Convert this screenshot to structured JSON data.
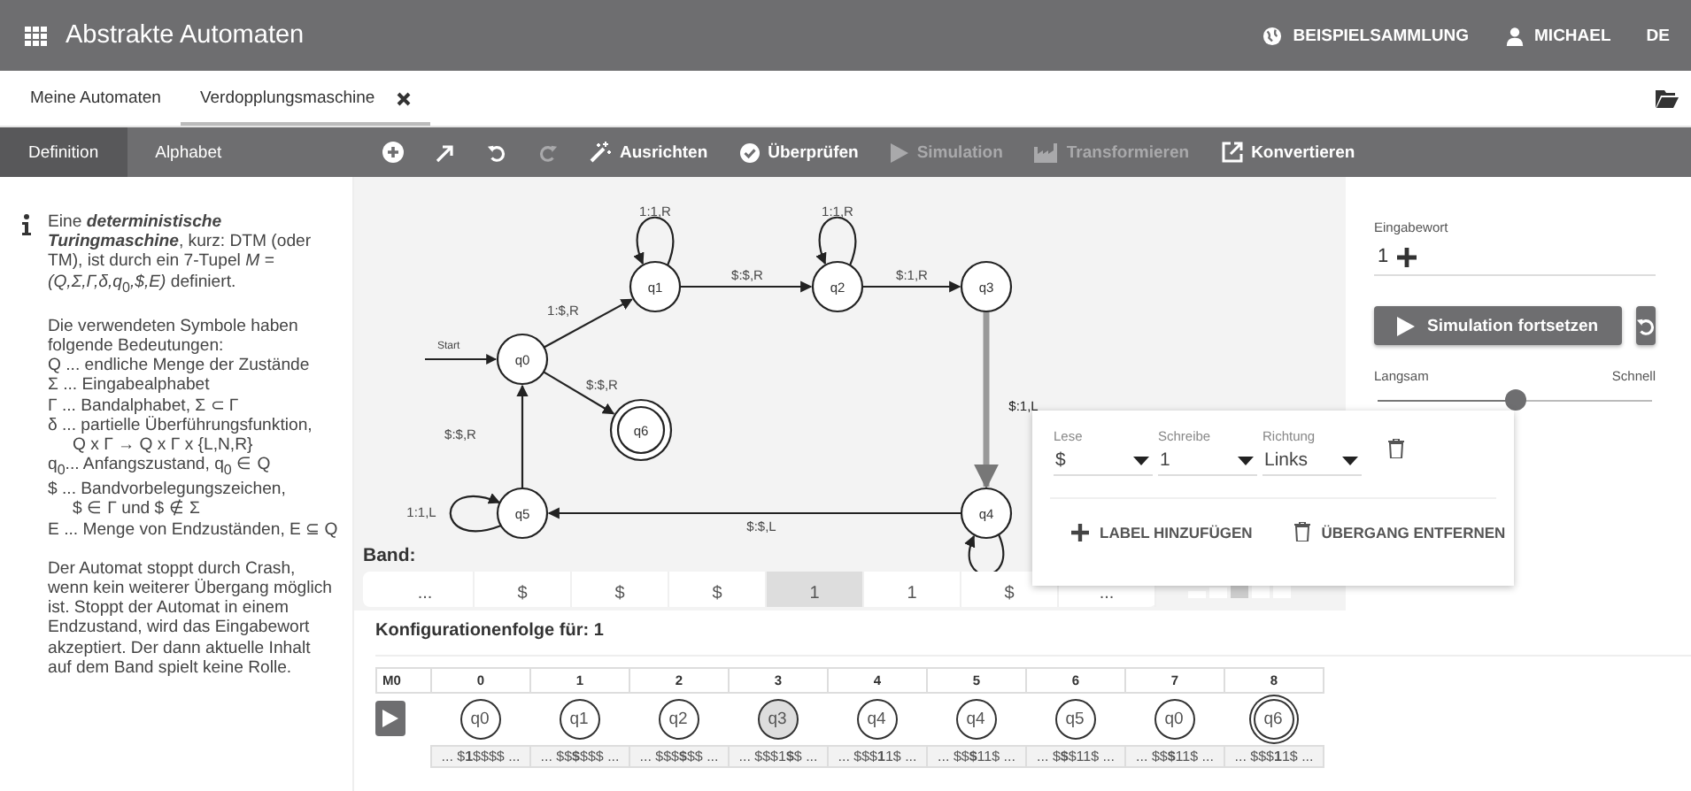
{
  "header": {
    "title": "Abstrakte Automaten",
    "links": [
      {
        "label": "BEISPIELSAMMLUNG"
      },
      {
        "label": "MICHAEL"
      },
      {
        "label": "DE"
      }
    ]
  },
  "tabs": [
    {
      "label": "Meine Automaten",
      "selected": false,
      "closable": false
    },
    {
      "label": "Verdopplungsmaschine",
      "selected": true,
      "closable": true
    }
  ],
  "toolbar": {
    "tabs": [
      {
        "label": "Definition",
        "selected": true
      },
      {
        "label": "Alphabet",
        "selected": false
      }
    ],
    "actions": [
      {
        "disabled": false
      },
      {
        "disabled": false
      },
      {
        "disabled": false
      },
      {
        "disabled": true
      },
      {
        "label": "Ausrichten",
        "disabled": false
      },
      {
        "label": "Überprüfen",
        "disabled": false
      },
      {
        "label": "Simulation",
        "disabled": true
      },
      {
        "label": "Transformieren",
        "disabled": true
      },
      {
        "label": "Konvertieren",
        "disabled": false
      }
    ]
  },
  "info": {
    "intro": "Eine **deterministische Turingmaschine**, kurz: DTM (oder TM), ist durch ein 7-Tupel *M = (Q,Σ,Γ,δ,q*$_{0}$*,$,E)* definiert.",
    "symbols_intro": "Die verwendeten Symbole haben folgende Bedeutungen:",
    "symbols": [
      {
        "text": "Q ... endliche Menge der Zustände"
      },
      {
        "text": "Σ ... Eingabealphabet"
      },
      {
        "text": "Γ ... Bandalphabet, Σ ⊂ Γ"
      },
      {
        "text": "δ ... partielle Überführungsfunktion,",
        "continuation": "Q x Γ → Q x Γ x {L,N,R}"
      },
      {
        "text": "q$_{0}$... Anfangszustand, q$_{0}$ ∈ Q"
      },
      {
        "text": "$ ... Bandvorbelegungszeichen,",
        "continuation": "$ ∈ Γ und $ ∉ Σ"
      },
      {
        "text": "E ... Menge von Endzuständen, E ⊆ Q"
      }
    ],
    "outro": "Der Automat stoppt durch Crash, wenn kein weiterer Übergang möglich ist. Stoppt der Automat in einem Endzustand, wird das Eingabewort akzeptiert. Der dann aktuelle Inhalt auf dem Band spielt keine Rolle."
  },
  "graph": {
    "start_label": "Start",
    "states": [
      {
        "label": "q0",
        "start": true,
        "final": false
      },
      {
        "label": "q1",
        "start": false,
        "final": false
      },
      {
        "label": "q2",
        "start": false,
        "final": false
      },
      {
        "label": "q3",
        "start": false,
        "final": false
      },
      {
        "label": "q4",
        "start": false,
        "final": false
      },
      {
        "label": "q5",
        "start": false,
        "final": false
      },
      {
        "label": "q6",
        "start": false,
        "final": true
      }
    ],
    "transitions": [
      {
        "label": "1:$,R",
        "highlighted": false
      },
      {
        "label": "1:1,R",
        "highlighted": false
      },
      {
        "label": "$:$,R",
        "highlighted": false
      },
      {
        "label": "1:1,R",
        "highlighted": false
      },
      {
        "label": "$:1,R",
        "highlighted": false
      },
      {
        "label": "$:1,L",
        "highlighted": true
      },
      {
        "highlighted": false
      },
      {
        "label": "$:$,L",
        "highlighted": false
      },
      {
        "label": "1:1,L",
        "highlighted": false
      },
      {
        "label": "$:$,R",
        "highlighted": false
      },
      {
        "label": "$:$,R",
        "highlighted": false
      }
    ]
  },
  "band": {
    "label": "Band:",
    "cells": [
      {
        "symbol": "...",
        "selected": false
      },
      {
        "symbol": "$",
        "selected": false
      },
      {
        "symbol": "$",
        "selected": false
      },
      {
        "symbol": "$",
        "selected": false
      },
      {
        "symbol": "1",
        "selected": true
      },
      {
        "symbol": "1",
        "selected": false
      },
      {
        "symbol": "$",
        "selected": false
      },
      {
        "symbol": "...",
        "selected": false
      }
    ]
  },
  "transition_editor": {
    "fields": [
      {
        "label": "Lese",
        "value": "$"
      },
      {
        "label": "Schreibe",
        "value": "1"
      },
      {
        "label": "Richtung",
        "value": "Links"
      }
    ],
    "buttons": [
      {
        "label": "LABEL HINZUFÜGEN"
      },
      {
        "label": "ÜBERGANG ENTFERNEN"
      }
    ]
  },
  "simulation": {
    "input_label": "Eingabewort",
    "input_value": "1",
    "run_button": "Simulation fortsetzen",
    "speed_min": "Langsam",
    "speed_max": "Schnell",
    "speed": {
      "level": 0.5
    }
  },
  "configurations": {
    "title": "Konfigurationenfolge für:",
    "word": "1",
    "first_column": "M0",
    "steps": [
      {
        "index": "0",
        "state": "q0",
        "final": false,
        "selected": false,
        "tape": "... $**1**$$$$ ..."
      },
      {
        "index": "1",
        "state": "q1",
        "final": false,
        "selected": false,
        "tape": "... $$**$**$$$ ..."
      },
      {
        "index": "2",
        "state": "q2",
        "final": false,
        "selected": false,
        "tape": "... $$$**$**$$ ..."
      },
      {
        "index": "3",
        "state": "q3",
        "final": false,
        "selected": true,
        "tape": "... $$$1**$**$ ..."
      },
      {
        "index": "4",
        "state": "q4",
        "final": false,
        "selected": false,
        "tape": "... $$$**1**1$ ..."
      },
      {
        "index": "5",
        "state": "q4",
        "final": false,
        "selected": false,
        "tape": "... $$**$**11$ ..."
      },
      {
        "index": "6",
        "state": "q5",
        "final": false,
        "selected": false,
        "tape": "... $**$**$11$ ..."
      },
      {
        "index": "7",
        "state": "q0",
        "final": false,
        "selected": false,
        "tape": "... $$**$**11$ ..."
      },
      {
        "index": "8",
        "state": "q6",
        "final": true,
        "selected": false,
        "tape": "... $$$**1**1$ ..."
      }
    ]
  }
}
